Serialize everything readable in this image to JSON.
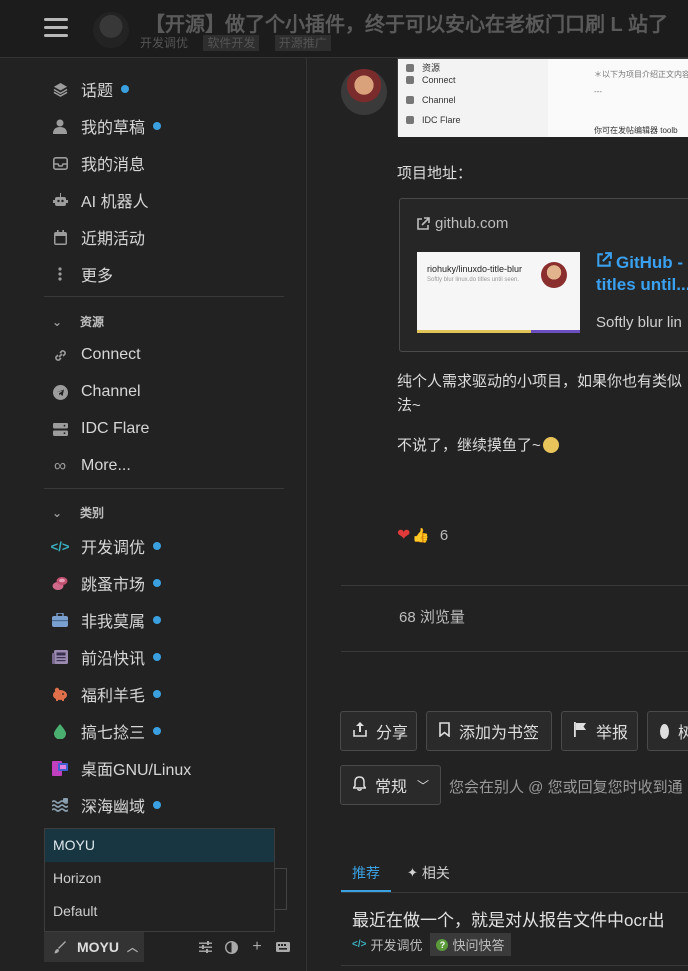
{
  "header": {
    "title": "【开源】做了个小插件，终于可以安心在老板门口刷 L 站了",
    "tags": [
      "开发调优",
      "软件开发",
      "开源推广"
    ]
  },
  "sidebar": {
    "nav": [
      {
        "label": "话题",
        "icon": "layers-icon",
        "dot": true
      },
      {
        "label": "我的草稿",
        "icon": "user-icon",
        "dot": true
      },
      {
        "label": "我的消息",
        "icon": "inbox-icon",
        "dot": false
      },
      {
        "label": "AI 机器人",
        "icon": "robot-icon",
        "dot": false
      },
      {
        "label": "近期活动",
        "icon": "calendar-icon",
        "dot": false
      },
      {
        "label": "更多",
        "icon": "more-vertical-icon",
        "dot": false
      }
    ],
    "resources_title": "资源",
    "resources": [
      {
        "label": "Connect",
        "icon": "link-icon"
      },
      {
        "label": "Channel",
        "icon": "telegram-icon"
      },
      {
        "label": "IDC Flare",
        "icon": "server-icon"
      },
      {
        "label": "More...",
        "icon": "infinity-icon"
      }
    ],
    "categories_title": "类别",
    "categories": [
      {
        "label": "开发调优",
        "icon": "code-icon",
        "color": "#3ab0c0",
        "dot": true
      },
      {
        "label": "跳蚤市场",
        "icon": "coins-icon",
        "color": "#d06a8a",
        "dot": true
      },
      {
        "label": "非我莫属",
        "icon": "briefcase-icon",
        "color": "#7aa0d0",
        "dot": true
      },
      {
        "label": "前沿快讯",
        "icon": "newspaper-icon",
        "color": "#9a8ab0",
        "dot": true
      },
      {
        "label": "福利羊毛",
        "icon": "piggy-bank-icon",
        "color": "#e0704a",
        "dot": true
      },
      {
        "label": "搞七捻三",
        "icon": "droplet-icon",
        "color": "#4ab070",
        "dot": true
      },
      {
        "label": "桌面GNU/Linux",
        "icon": "desktop-icon",
        "color": "#c040c0",
        "dot": false
      },
      {
        "label": "深海幽域",
        "icon": "waves-icon",
        "color": "#8aa0b0",
        "dot": true
      }
    ],
    "theme_options": [
      "MOYU",
      "Horizon",
      "Default"
    ],
    "theme_selected": "MOYU",
    "footer_icons": [
      "sliders-icon",
      "contrast-icon",
      "plus-icon",
      "keyboard-icon"
    ]
  },
  "post": {
    "screenshot_items": [
      "资源",
      "Connect",
      "Channel",
      "IDC Flare"
    ],
    "screenshot_right": [
      "＊以下为项目介绍正文内容",
      "---",
      "你可在发帖编辑器 toolb"
    ],
    "project_label": "项目地址：",
    "onebox": {
      "source": "github.com",
      "thumb_title": "riohuky/linuxdo-title-blur",
      "thumb_sub": "Softly blur linux.do titles until seen.",
      "title_line1": "GitHub -",
      "title_line2": "titles until...",
      "desc": "Softly blur lin"
    },
    "para1_line1": "纯个人需求驱动的小项目，如果你也有类似",
    "para1_line2": "法~",
    "para2": "不说了，继续摸鱼了~",
    "reaction_count": "6",
    "views": "68",
    "views_label": "浏览量"
  },
  "actions": {
    "share": "分享",
    "bookmark": "添加为书签",
    "flag": "举报",
    "status": "树",
    "notify_level": "常规",
    "notify_text": "您会在别人 @ 您或回复您时收到通"
  },
  "related": {
    "tab_suggested": "推荐",
    "tab_related": "相关",
    "topic_title": "最近在做一个，就是对从报告文件中ocr出",
    "topic_category": "开发调优",
    "topic_tag": "快问快答"
  }
}
